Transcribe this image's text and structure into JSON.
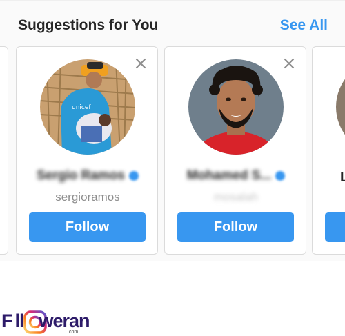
{
  "header": {
    "title": "Suggestions for You",
    "see_all": "See All"
  },
  "cards": [
    {
      "name": "Sergio Ramos",
      "username": "sergioramos",
      "verified": true,
      "follow_label": "Follow"
    },
    {
      "name": "Mohamed S...",
      "username": "mosalah",
      "verified": true,
      "follow_label": "Follow"
    },
    {
      "name_partial": "L"
    }
  ],
  "watermark": {
    "logo_text_a": "F",
    "logo_text_b": "ll",
    "logo_text_c": "weran",
    "logo_suffix": ".com"
  },
  "colors": {
    "accent": "#3897f0",
    "text": "#262626",
    "muted": "#8e8e8e"
  }
}
